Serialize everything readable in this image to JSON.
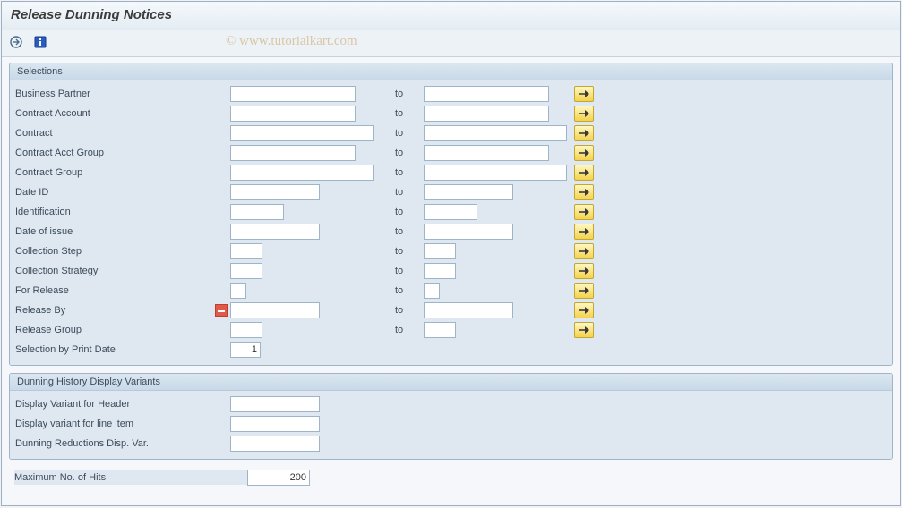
{
  "title": "Release Dunning Notices",
  "watermark": "© www.tutorialkart.com",
  "toolbar": {
    "execute_tooltip": "Execute",
    "info_tooltip": "Information"
  },
  "groups": {
    "selections": {
      "title": "Selections",
      "to_label": "to",
      "rows": [
        {
          "label": "Business Partner",
          "from_w": "w-lg",
          "to_w": "w-lg",
          "required": false,
          "mo": true
        },
        {
          "label": "Contract Account",
          "from_w": "w-lg",
          "to_w": "w-lg",
          "required": false,
          "mo": true
        },
        {
          "label": "Contract",
          "from_w": "w-xl",
          "to_w": "w-xl",
          "required": false,
          "mo": true
        },
        {
          "label": "Contract Acct Group",
          "from_w": "w-lg",
          "to_w": "w-lg",
          "required": false,
          "mo": true
        },
        {
          "label": "Contract Group",
          "from_w": "w-xl",
          "to_w": "w-xl",
          "required": false,
          "mo": true
        },
        {
          "label": "Date ID",
          "from_w": "w-md",
          "to_w": "w-md",
          "required": false,
          "mo": true
        },
        {
          "label": "Identification",
          "from_w": "w-sm",
          "to_w": "w-sm",
          "required": false,
          "mo": true
        },
        {
          "label": "Date of issue",
          "from_w": "w-md",
          "to_w": "w-md",
          "required": false,
          "mo": true
        },
        {
          "label": "Collection Step",
          "from_w": "w-xs",
          "to_w": "w-xs",
          "required": false,
          "mo": true
        },
        {
          "label": "Collection Strategy",
          "from_w": "w-xs",
          "to_w": "w-xs",
          "required": false,
          "mo": true
        },
        {
          "label": "For Release",
          "from_w": "w-tiny",
          "to_w": "w-tiny",
          "required": false,
          "mo": true
        },
        {
          "label": "Release By",
          "from_w": "w-md",
          "to_w": "w-md",
          "required": true,
          "mo": true
        },
        {
          "label": "Release Group",
          "from_w": "w-xs",
          "to_w": "w-xs",
          "required": false,
          "mo": true
        }
      ],
      "print_date": {
        "label": "Selection by Print Date",
        "value": "1"
      }
    },
    "variants": {
      "title": "Dunning History Display Variants",
      "rows": [
        {
          "label": "Display Variant for Header"
        },
        {
          "label": "Display variant for line item"
        },
        {
          "label": "Dunning Reductions Disp. Var."
        }
      ]
    }
  },
  "footer": {
    "max_hits_label": "Maximum No. of Hits",
    "max_hits_value": "200"
  }
}
